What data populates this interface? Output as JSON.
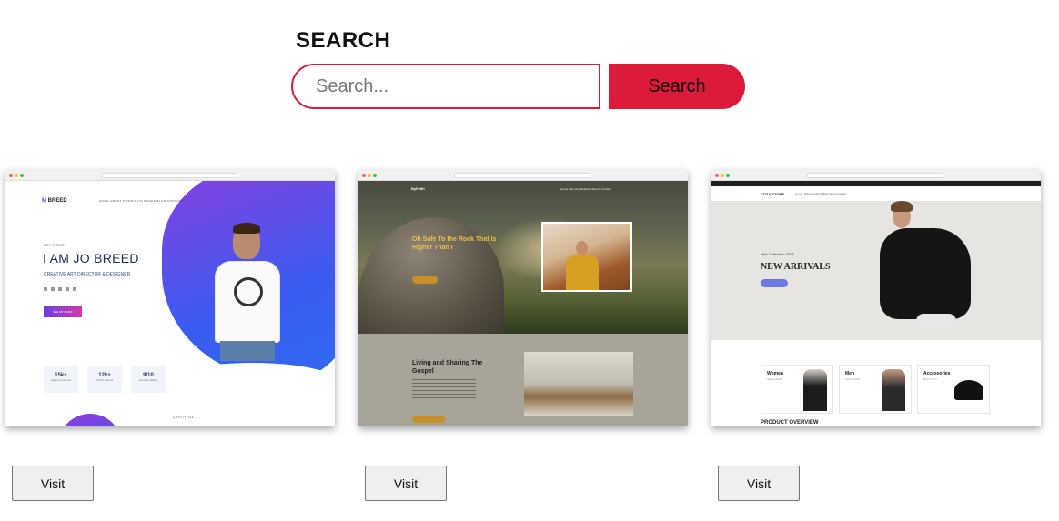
{
  "search": {
    "title": "SEARCH",
    "placeholder": "Search...",
    "value": "",
    "button_label": "Search"
  },
  "colors": {
    "accent": "#dc1a3a",
    "button_bg": "#efefef"
  },
  "cards": [
    {
      "preview": {
        "logo": "BREED",
        "nav": "HOME   ABOUT   PORTFOLIO   PAGES   BLOG   CONTACT",
        "greeting": "HEY THERE !",
        "heading": "I AM JO BREED",
        "role": "CREATIVE ART DIRECTOR & DESIGNER",
        "cta": "SEE MY WORK",
        "stats": [
          {
            "value": "15k+",
            "label": "Happy Customer"
          },
          {
            "value": "12k+",
            "label": "Ticket Solved"
          },
          {
            "value": "9/10",
            "label": "Average Rating"
          }
        ],
        "about": "ABOUT ME"
      },
      "visit_label": "Visit"
    },
    {
      "preview": {
        "logo": "ByFaith",
        "nav": "Home   Sermons   Ministries   Events   Contact",
        "heading": "Oh Safe To the Rock That Is Higher Than I",
        "section_title": "Living and Sharing The Gospel"
      },
      "visit_label": "Visit"
    },
    {
      "preview": {
        "brand": "COZA STORE",
        "nav_active": "Home",
        "nav": "Shop   Features   Blog   About   Contact",
        "collection": "Men Collection 2018",
        "heading": "NEW ARRIVALS",
        "categories": [
          {
            "name": "Women",
            "sub": "Spring 2018"
          },
          {
            "name": "Men",
            "sub": "Spring 2018"
          },
          {
            "name": "Accessories",
            "sub": "New Trend"
          }
        ],
        "overview": "PRODUCT OVERVIEW"
      },
      "visit_label": "Visit"
    }
  ]
}
